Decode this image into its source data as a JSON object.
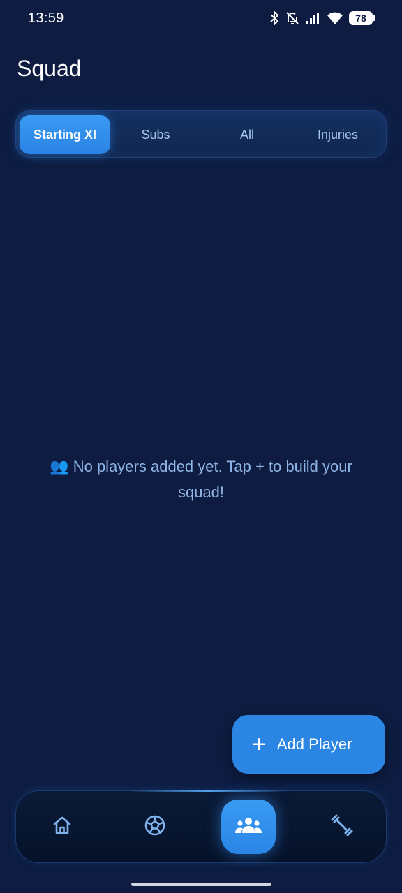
{
  "status_bar": {
    "time": "13:59",
    "battery_level": "78",
    "icons": [
      "bluetooth-icon",
      "muted-bell-icon",
      "signal-icon",
      "wifi-icon",
      "battery-icon"
    ]
  },
  "page": {
    "title": "Squad"
  },
  "tabs": [
    {
      "label": "Starting XI",
      "active": true
    },
    {
      "label": "Subs",
      "active": false
    },
    {
      "label": "All",
      "active": false
    },
    {
      "label": "Injuries",
      "active": false
    }
  ],
  "empty_state": {
    "icon": "👥",
    "message": "No players added yet. Tap + to build your squad!"
  },
  "fab": {
    "icon": "+",
    "label": "Add Player"
  },
  "bottom_nav": [
    {
      "icon": "home-icon",
      "active": false
    },
    {
      "icon": "football-icon",
      "active": false
    },
    {
      "icon": "group-icon",
      "active": true
    },
    {
      "icon": "dumbbell-icon",
      "active": false
    }
  ],
  "colors": {
    "background": "#0d1c40",
    "accent": "#2a86e2",
    "tab_text": "#a9c6ef",
    "empty_text": "#8fb4e6",
    "nav_icon": "#7fb3ee"
  }
}
